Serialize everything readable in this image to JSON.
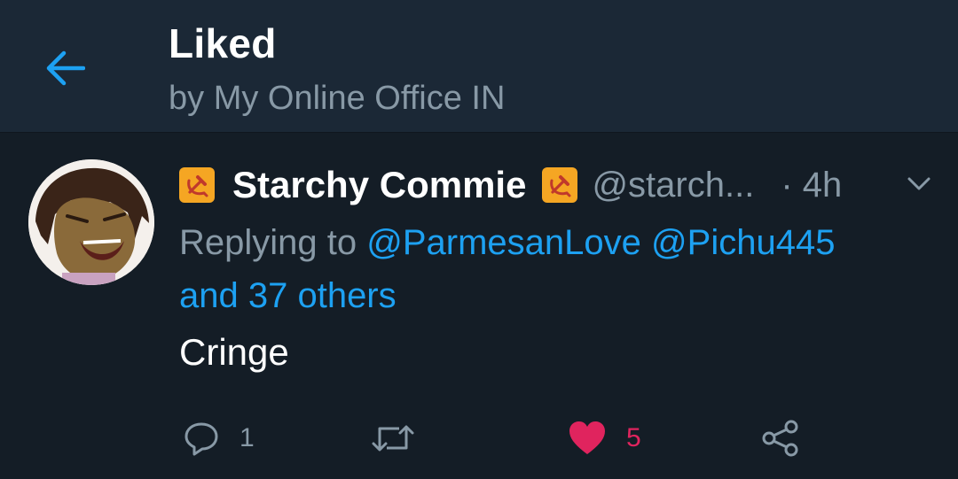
{
  "header": {
    "title": "Liked",
    "subtitle": "by My Online Office IN",
    "back_icon": "arrow-left-icon"
  },
  "tweet": {
    "display_name": "Starchy Commie",
    "name_emoji": "hammer-and-sickle-flag",
    "handle": "@starch...",
    "time": "· 4h",
    "reply_prefix": "Replying to",
    "mentions": [
      "@ParmesanLove",
      "@Pichu445"
    ],
    "others": "and 37 others",
    "text": "Cringe",
    "actions": {
      "reply_count": "1",
      "retweet_count": "",
      "like_count": "5",
      "liked": true
    }
  },
  "colors": {
    "header_bg": "#1b2836",
    "body_bg": "#141d26",
    "accent": "#1da1f2",
    "muted": "#8899a6",
    "like": "#e0245e",
    "flag": "#f5a623"
  }
}
